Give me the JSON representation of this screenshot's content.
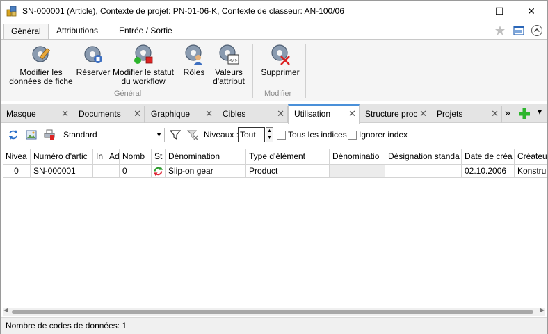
{
  "window": {
    "title": "SN-000001 (Article), Contexte de projet: PN-01-06-K, Contexte de classeur: AN-100/06",
    "minimize_glyph": "—",
    "maximize_glyph": "☐",
    "close_glyph": "✕"
  },
  "ribbon_tabs": [
    {
      "label": "Général",
      "active": true
    },
    {
      "label": "Attributions",
      "active": false
    },
    {
      "label": "Entrée / Sortie",
      "active": false
    }
  ],
  "ribbon": {
    "groups": [
      {
        "label": "Général"
      },
      {
        "label": "Modifier"
      }
    ],
    "buttons": [
      {
        "line1": "Modifier les",
        "line2": "données de fiche",
        "icon": "edit-gear-icon"
      },
      {
        "line1": "Réserver",
        "line2": "",
        "icon": "reserve-gear-icon"
      },
      {
        "line1": "Modifier le statut",
        "line2": "du workflow",
        "icon": "workflow-gear-icon"
      },
      {
        "line1": "Rôles",
        "line2": "",
        "icon": "roles-gear-icon"
      },
      {
        "line1": "Valeurs",
        "line2": "d'attribut",
        "icon": "attribute-gear-icon"
      },
      {
        "line1": "Supprimer",
        "line2": "",
        "icon": "delete-gear-icon"
      }
    ]
  },
  "doc_tabs": [
    {
      "label": "Masque",
      "active": false
    },
    {
      "label": "Documents",
      "active": false
    },
    {
      "label": "Graphique",
      "active": false
    },
    {
      "label": "Cibles",
      "active": false
    },
    {
      "label": "Utilisation",
      "active": true
    },
    {
      "label": "Structure proc",
      "active": false
    },
    {
      "label": "Projets",
      "active": false
    }
  ],
  "doc_tabs_overflow": "»",
  "doc_tabs_dropdown": "▾",
  "toolbar": {
    "view_select": "Standard",
    "levels_label": "Niveaux :",
    "levels_value": "Tout",
    "all_indices_label": "Tous les indices",
    "ignore_index_label": "Ignorer index"
  },
  "table": {
    "columns": [
      "Nivea",
      "Numéro d'artic",
      "In",
      "Ad",
      "Nomb",
      "St",
      "Dénomination",
      "Type d'élément",
      "Dénominatio",
      "Désignation standa",
      "Date de créa",
      "Créateu"
    ],
    "rows": [
      [
        "0",
        "SN-000001",
        "",
        "",
        "0",
        "",
        "Slip-on gear",
        "Product",
        "",
        "",
        "02.10.2006",
        "Konstruk"
      ]
    ]
  },
  "status": "Nombre de codes de données: 1",
  "colors": {
    "accent": "#4a90d9",
    "add_green": "#2db52d"
  }
}
